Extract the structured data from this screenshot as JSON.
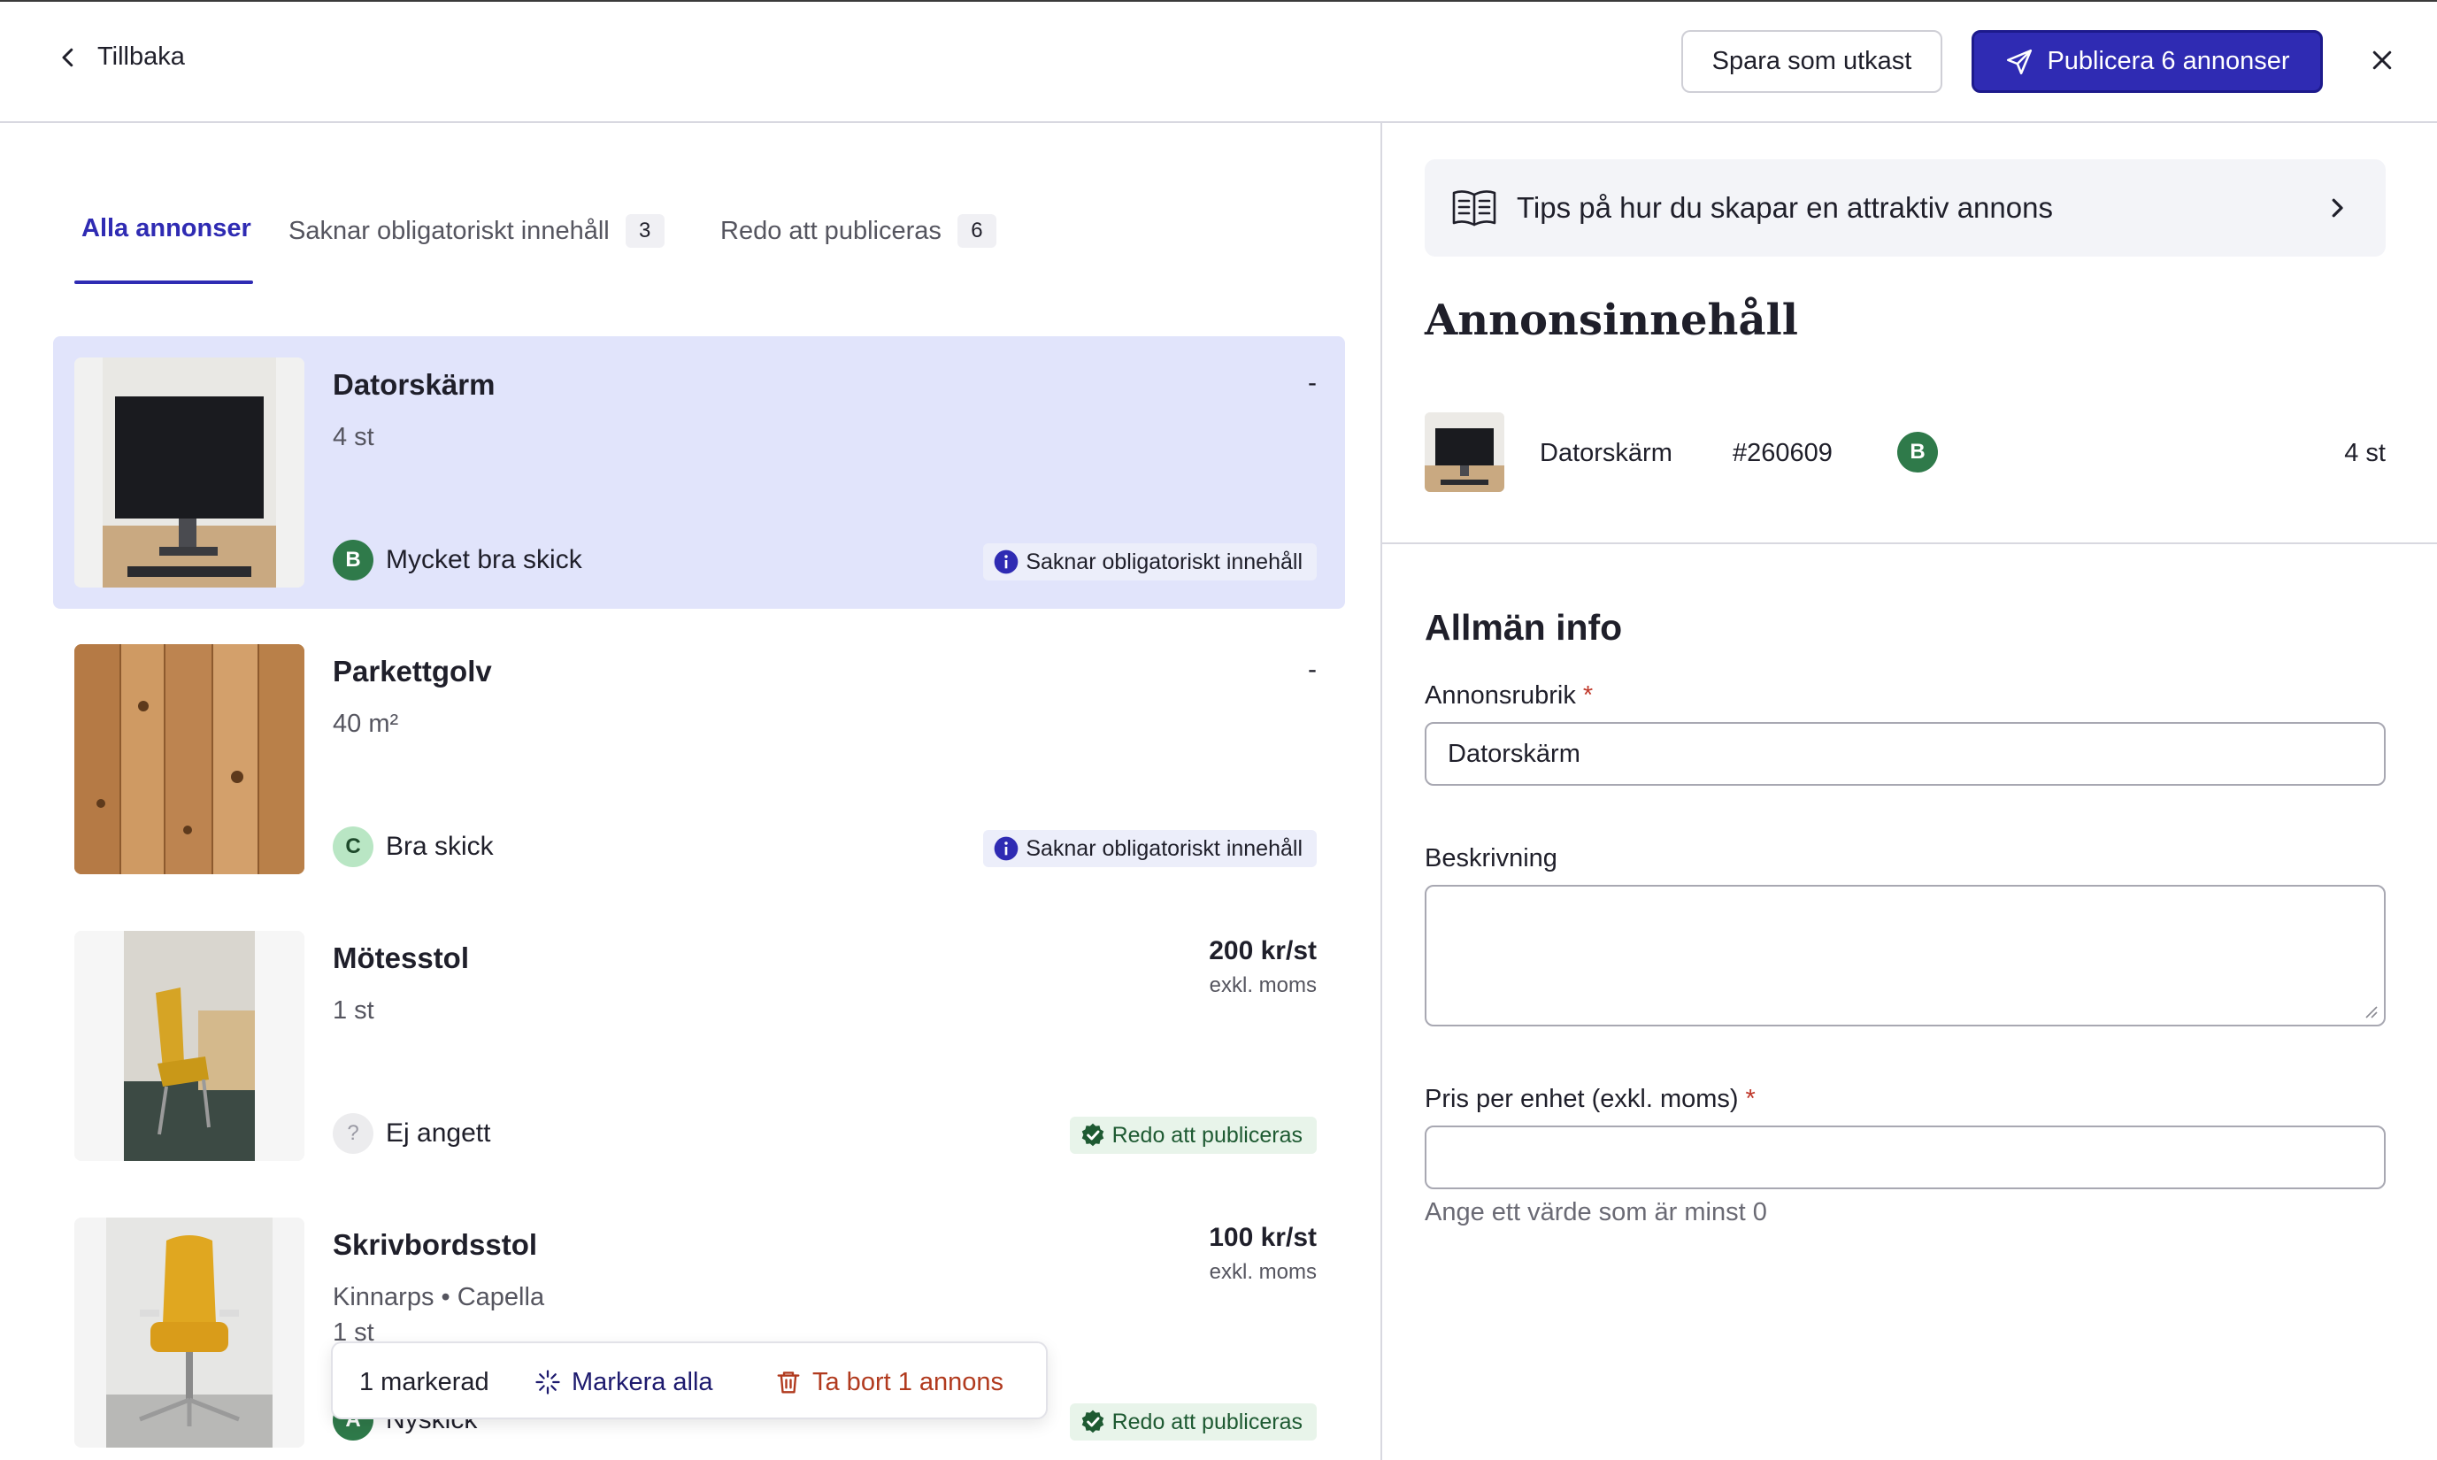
{
  "header": {
    "back_label": "Tillbaka",
    "save_draft_label": "Spara som utkast",
    "publish_label": "Publicera 6 annonser"
  },
  "tabs": [
    {
      "label": "Alla annonser",
      "count": "",
      "active": true
    },
    {
      "label": "Saknar obligatoriskt innehåll",
      "count": "3",
      "active": false
    },
    {
      "label": "Redo att publiceras",
      "count": "6",
      "active": false
    }
  ],
  "listings": [
    {
      "title": "Datorskärm",
      "subtitle": "4 st",
      "price": "-",
      "price_note": "",
      "grade": "B",
      "condition": "Mycket bra skick",
      "status": "Saknar obligatoriskt innehåll",
      "status_type": "missing",
      "selected": true
    },
    {
      "title": "Parkettgolv",
      "subtitle": "40 m²",
      "price": "-",
      "price_note": "",
      "grade": "C",
      "condition": "Bra skick",
      "status": "Saknar obligatoriskt innehåll",
      "status_type": "missing",
      "selected": false
    },
    {
      "title": "Mötesstol",
      "subtitle": "1 st",
      "price": "200 kr/st",
      "price_note": "exkl. moms",
      "grade": "?",
      "condition": "Ej angett",
      "status": "Redo att publiceras",
      "status_type": "ready",
      "selected": false
    },
    {
      "title": "Skrivbordsstol",
      "subtitle": "Kinnarps • Capella",
      "subtitle2": "1 st",
      "price": "100 kr/st",
      "price_note": "exkl. moms",
      "grade": "A",
      "condition": "Nyskick",
      "status": "Redo att publiceras",
      "status_type": "ready",
      "selected": false
    }
  ],
  "action_bar": {
    "count_label": "1 markerad",
    "select_all_label": "Markera alla",
    "delete_label": "Ta bort 1 annons"
  },
  "right_panel": {
    "tips_label": "Tips på hur du skapar en attraktiv annons",
    "content_heading": "Annonsinnehåll",
    "summary": {
      "name": "Datorskärm",
      "id": "#260609",
      "grade": "B",
      "quantity": "4 st"
    },
    "general_heading": "Allmän info",
    "title_label": "Annonsrubrik",
    "title_value": "Datorskärm",
    "description_label": "Beskrivning",
    "description_value": "",
    "price_label": "Pris per enhet (exkl. moms)",
    "price_value": "",
    "price_help": "Ange ett värde som är minst 0",
    "required_mark": "*"
  },
  "colors": {
    "accent": "#2f2bb3",
    "selected_bg": "#e1e4fb",
    "grade_b": "#2f7a4a",
    "grade_c": "#b9e6c4",
    "ready_green": "#1e5a32",
    "delete_red": "#b13a1e",
    "required_red": "#c0392b"
  }
}
